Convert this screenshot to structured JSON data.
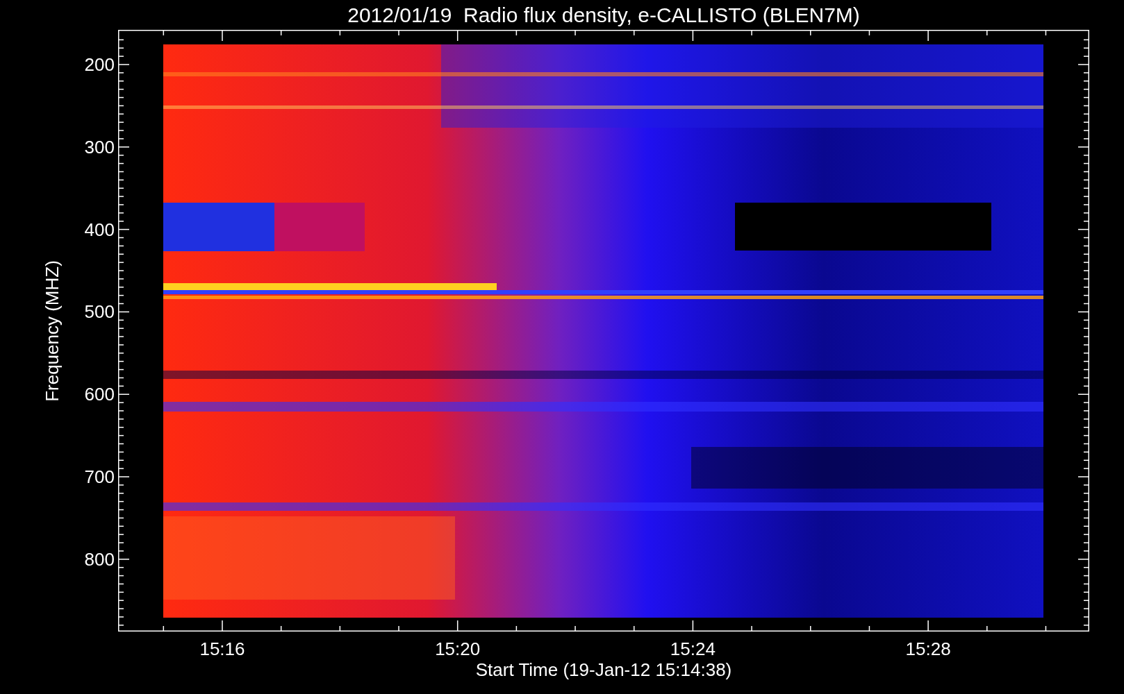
{
  "title": "2012/01/19  Radio flux density, e-CALLISTO (BLEN7M)",
  "y_axis": {
    "label": "Frequency (MHZ)",
    "ticks": [
      "200",
      "300",
      "400",
      "500",
      "600",
      "700",
      "800"
    ]
  },
  "x_axis": {
    "label": "Start Time (19-Jan-12 15:14:38)",
    "ticks": [
      "15:16",
      "15:20",
      "15:24",
      "15:28"
    ]
  }
}
